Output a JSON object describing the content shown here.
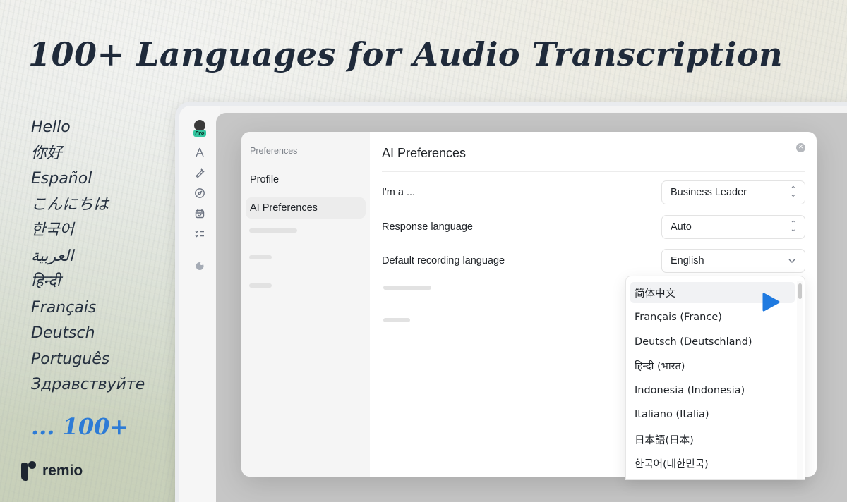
{
  "headline": "100+ Languages for Audio Transcription",
  "greetings": [
    "Hello",
    "你好",
    "Español",
    "こんにちは",
    "한국어",
    "العربية",
    "हिन्दी",
    "Français",
    "Deutsch",
    "Português",
    "Здравствуйте"
  ],
  "more_label": "... 100+",
  "brand": {
    "name": "remio",
    "icon": "remio-logo"
  },
  "colors": {
    "accent": "#2d7bd6",
    "headline": "#1f2a3a",
    "cursor": "#1f7ae0",
    "pro_badge": "#34c6a0"
  },
  "rail": {
    "avatar_badge": "Pro",
    "icons": [
      "apps-icon",
      "wrench-icon",
      "compass-icon",
      "calendar-icon",
      "checklist-icon",
      "brain-icon"
    ]
  },
  "modal": {
    "nav_heading": "Preferences",
    "nav_items": [
      {
        "label": "Profile",
        "active": false
      },
      {
        "label": "AI Preferences",
        "active": true
      }
    ],
    "title": "AI Preferences",
    "close_icon": "close-icon",
    "settings": [
      {
        "label": "I'm a ...",
        "value": "Business Leader",
        "control": "stepper-select"
      },
      {
        "label": "Response language",
        "value": "Auto",
        "control": "stepper-select"
      },
      {
        "label": "Default recording language",
        "value": "English",
        "control": "dropdown"
      }
    ]
  },
  "language_dropdown": {
    "options": [
      "简体中文",
      "Français (France)",
      "Deutsch (Deutschland)",
      "हिन्दी (भारत)",
      "Indonesia (Indonesia)",
      "Italiano (Italia)",
      "日本語(日本)",
      "한국어(대한민국)"
    ],
    "hovered_index": 0
  }
}
